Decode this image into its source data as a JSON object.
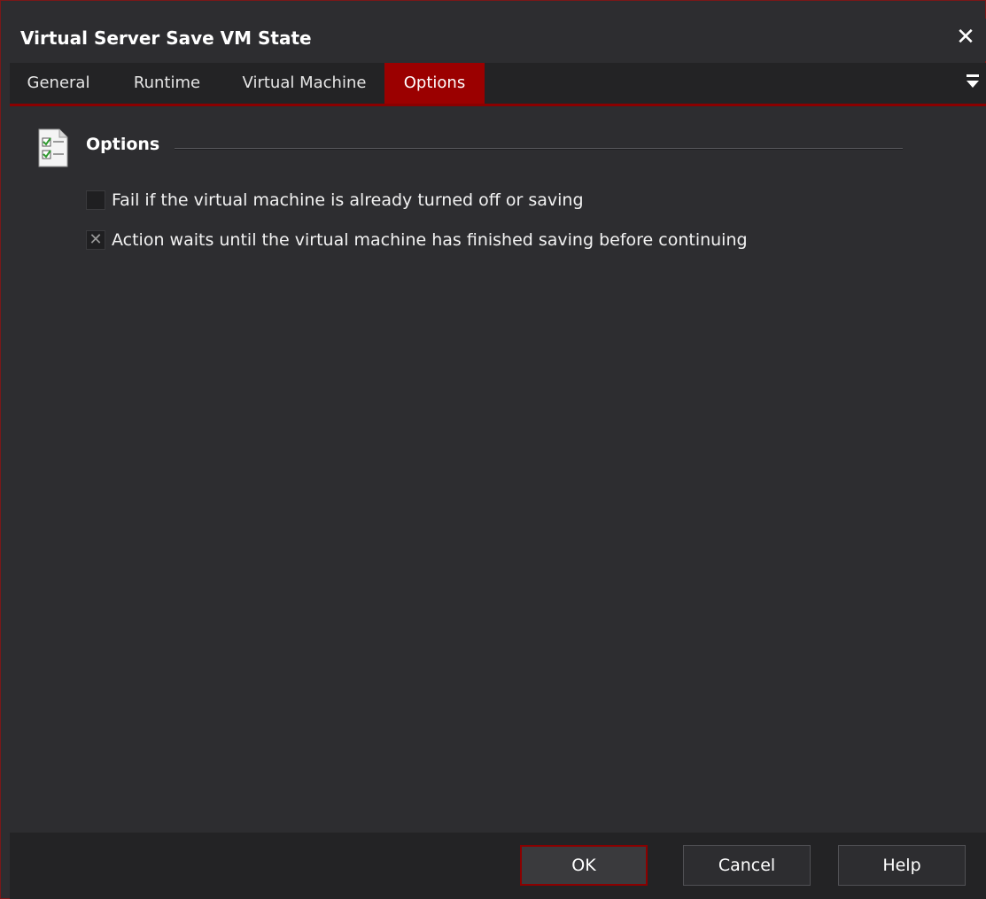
{
  "window": {
    "title": "Virtual Server Save VM State",
    "close_icon": "close-icon"
  },
  "tabs": [
    {
      "label": "General",
      "active": false
    },
    {
      "label": "Runtime",
      "active": false
    },
    {
      "label": "Virtual Machine",
      "active": false
    },
    {
      "label": "Options",
      "active": true
    }
  ],
  "tabbar": {
    "overflow_icon": "overflow-menu-icon"
  },
  "section": {
    "title": "Options",
    "icon": "checklist-icon"
  },
  "options": [
    {
      "label": "Fail if the virtual machine is already turned off or saving",
      "checked": false
    },
    {
      "label": "Action waits until the virtual machine has finished saving before continuing",
      "checked": true
    }
  ],
  "footer": {
    "ok_label": "OK",
    "cancel_label": "Cancel",
    "help_label": "Help"
  },
  "colors": {
    "accent": "#9b0000",
    "background": "#2d2d30",
    "footer_background": "#232325"
  }
}
